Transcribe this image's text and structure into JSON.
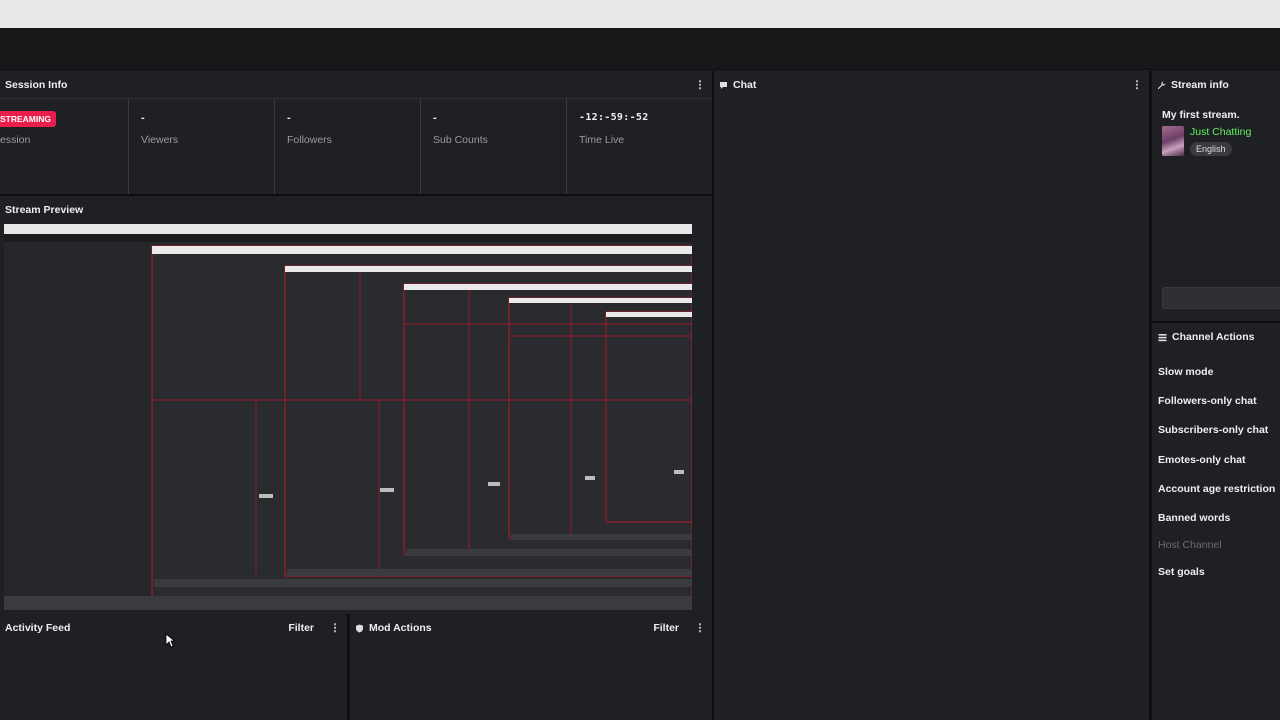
{
  "session": {
    "title": "Session Info",
    "badge": "STREAMING",
    "session_label": "ession",
    "stats": [
      {
        "value": "-",
        "label": "Viewers"
      },
      {
        "value": "-",
        "label": "Followers"
      },
      {
        "value": "-",
        "label": "Sub Counts"
      },
      {
        "value": "-12:-59:-52",
        "label": "Time Live"
      }
    ]
  },
  "preview": {
    "title": "Stream Preview"
  },
  "activity": {
    "title": "Activity Feed",
    "filter": "Filter"
  },
  "mod": {
    "title": "Mod Actions",
    "filter": "Filter"
  },
  "chat": {
    "title": "Chat"
  },
  "stream_info": {
    "title": "Stream info",
    "stream_title": "My first stream.",
    "category": "Just Chatting",
    "category_color": "#5ff25f",
    "tag": "English"
  },
  "channel_actions": {
    "title": "Channel Actions",
    "items": [
      {
        "label": "Slow mode"
      },
      {
        "label": "Followers-only chat"
      },
      {
        "label": "Subscribers-only chat"
      },
      {
        "label": "Emotes-only chat"
      },
      {
        "label": "Account age restriction"
      },
      {
        "label": "Banned words"
      },
      {
        "label": "Host Channel"
      },
      {
        "label": "Set goals"
      }
    ]
  },
  "colors": {
    "accent_badge": "#e91e4d",
    "background": "#1f2023"
  }
}
